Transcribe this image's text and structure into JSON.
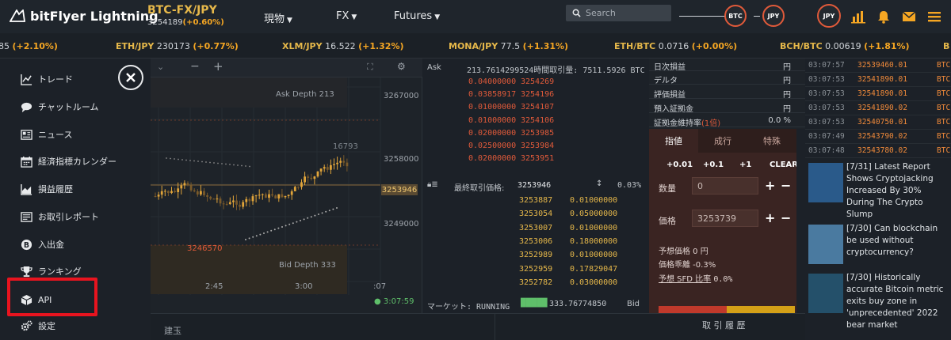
{
  "header": {
    "brand": "bitFlyer Lightning",
    "pair": {
      "name": "BTC-FX/JPY",
      "price": "3254189",
      "change": "(+0.60%)"
    },
    "nav": [
      "現物",
      "FX",
      "Futures"
    ],
    "search_placeholder": "Search",
    "coins": [
      "BTC",
      "JPY",
      "JPY"
    ],
    "colors": {
      "accent": "#f5a623",
      "brand_gold": "#e6b84a",
      "sell": "#e05a3a"
    }
  },
  "ticker": [
    {
      "pair": "",
      "price": "85",
      "change": "(+2.10%)"
    },
    {
      "pair": "ETH/JPY",
      "price": "230173",
      "change": "(+0.77%)"
    },
    {
      "pair": "XLM/JPY",
      "price": "16.522",
      "change": "(+1.32%)"
    },
    {
      "pair": "MONA/JPY",
      "price": "77.5",
      "change": "(+1.31%)"
    },
    {
      "pair": "ETH/BTC",
      "price": "0.0716",
      "change": "(+0.00%)"
    },
    {
      "pair": "BCH/BTC",
      "price": "0.00619",
      "change": "(+1.81%)"
    },
    {
      "pair": "B",
      "price": "",
      "change": ""
    }
  ],
  "sidebar": {
    "items": [
      {
        "label": "トレード",
        "icon": "chart-line-icon"
      },
      {
        "label": "チャットルーム",
        "icon": "chat-bubble-icon"
      },
      {
        "label": "ニュース",
        "icon": "newspaper-icon"
      },
      {
        "label": "経済指標カレンダー",
        "icon": "calendar-icon"
      },
      {
        "label": "損益履歴",
        "icon": "area-chart-icon"
      },
      {
        "label": "お取引レポート",
        "icon": "report-icon"
      },
      {
        "label": "入出金",
        "icon": "bitcoin-icon"
      },
      {
        "label": "ランキング",
        "icon": "trophy-icon"
      },
      {
        "label": "API",
        "icon": "cube-icon"
      },
      {
        "label": "設定",
        "icon": "gears-icon"
      }
    ]
  },
  "chart": {
    "ask_depth": "Ask Depth 213",
    "bid_depth": "Bid Depth 333",
    "y_ticks": [
      "3267000",
      "3258000",
      "3249000"
    ],
    "x_ticks": [
      "2:45",
      "3:00",
      ":07"
    ],
    "hi_label": "16793",
    "lo_label": "3246570",
    "price_tag": "3253946",
    "clock": "3:07:59"
  },
  "book": {
    "ask_label": "Ask",
    "header": "213.7614299524時間取引量: 7511.5926 BTC",
    "asks": [
      {
        "size": "0.04000000",
        "price": "3254269"
      },
      {
        "size": "0.03858917",
        "price": "3254196"
      },
      {
        "size": "0.01000000",
        "price": "3254107"
      },
      {
        "size": "0.01000000",
        "price": "3254106"
      },
      {
        "size": "0.02000000",
        "price": "3253985"
      },
      {
        "size": "0.02500000",
        "price": "3253984"
      },
      {
        "size": "0.02000000",
        "price": "3253951"
      }
    ],
    "last_label": "最終取引価格:",
    "last_price": "3253946",
    "last_pct": "0.03%",
    "bids": [
      {
        "price": "3253887",
        "size": "0.01000000"
      },
      {
        "price": "3253054",
        "size": "0.05000000"
      },
      {
        "price": "3253007",
        "size": "0.01000000"
      },
      {
        "price": "3253006",
        "size": "0.18000000"
      },
      {
        "price": "3252989",
        "size": "0.01000000"
      },
      {
        "price": "3252959",
        "size": "0.17829047"
      },
      {
        "price": "3252782",
        "size": "0.03000000"
      }
    ],
    "market_label": "マーケット: RUNNING",
    "market_vol": "333.76774850",
    "bid_label": "Bid"
  },
  "stats": {
    "rows": [
      {
        "k": "日次損益",
        "v": "円"
      },
      {
        "k": "デルタ",
        "v": "円"
      },
      {
        "k": "評価損益",
        "v": "円"
      },
      {
        "k": "預入証拠金",
        "v": "円"
      },
      {
        "k": "証拠金維持率",
        "k2": "(1倍)",
        "v": "0.0 %"
      }
    ]
  },
  "order": {
    "tabs": [
      "指値",
      "成行",
      "特殊"
    ],
    "amounts": [
      "+0.01",
      "+0.1",
      "+1",
      "CLEAR"
    ],
    "qty_label": "数量",
    "qty_value": "0",
    "price_label": "価格",
    "price_value": "3253739",
    "est_price": "予想価格 0 円",
    "deviation": "価格乖離 -0.3%",
    "sfd": "予想 SFD 比率",
    "sfd_value": "0.0%"
  },
  "history": [
    {
      "t": "03:07:57",
      "p": "32539460.01",
      "m": "BTC"
    },
    {
      "t": "03:07:53",
      "p": "32541890.01",
      "m": "BTC"
    },
    {
      "t": "03:07:53",
      "p": "32541890.01",
      "m": "BTC"
    },
    {
      "t": "03:07:53",
      "p": "32541890.02",
      "m": "BTC"
    },
    {
      "t": "03:07:53",
      "p": "32540750.01",
      "m": "BTC"
    },
    {
      "t": "03:07:49",
      "p": "32543790.02",
      "m": "BTC"
    },
    {
      "t": "03:07:48",
      "p": "32543780.02",
      "m": "BTC"
    }
  ],
  "news": [
    {
      "text": "[7/31] Latest Report Shows Cryptojacking Increased By 30% During The Crypto Slump"
    },
    {
      "text": "[7/30] Can blockchain be used without cryptocurrency?"
    },
    {
      "text": "[7/30] Historically accurate Bitcoin metric exits buy zone in 'unprecedented' 2022 bear market"
    }
  ],
  "bottom": {
    "positions": "建玉",
    "history": "取 引 履 歴"
  }
}
